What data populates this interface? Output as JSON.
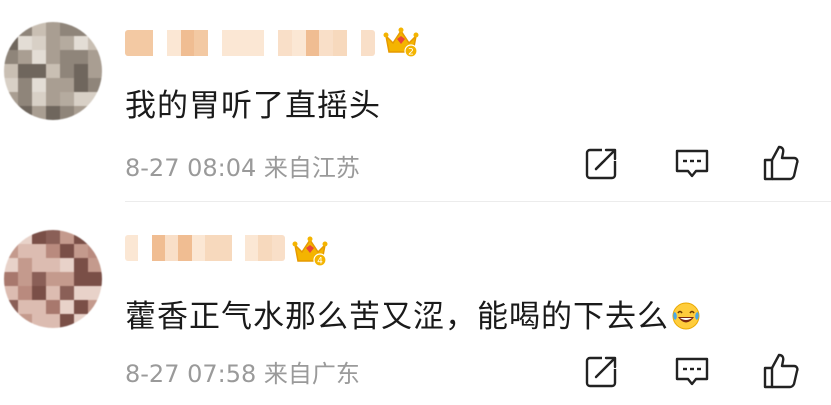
{
  "comments": [
    {
      "text": "我的胃听了直摇头",
      "date": "8-27 08:04",
      "location": "来自江苏",
      "badge": "2"
    },
    {
      "text": "藿香正气水那么苦又涩，能喝的下去么",
      "date": "8-27 07:58",
      "location": "来自广东",
      "badge": "4",
      "emoji": "laughing-tears-emoji"
    }
  ],
  "icons": {
    "share": "share-icon",
    "reply": "comment-icon",
    "like": "thumbs-up-icon",
    "crown": "crown-level-icon"
  },
  "colors": {
    "crown_gold": "#f4b400",
    "crown_red": "#e8463a",
    "meta_gray": "#9a9a9a",
    "text": "#1a1a1a",
    "name_blur": "#f6d3b0"
  }
}
